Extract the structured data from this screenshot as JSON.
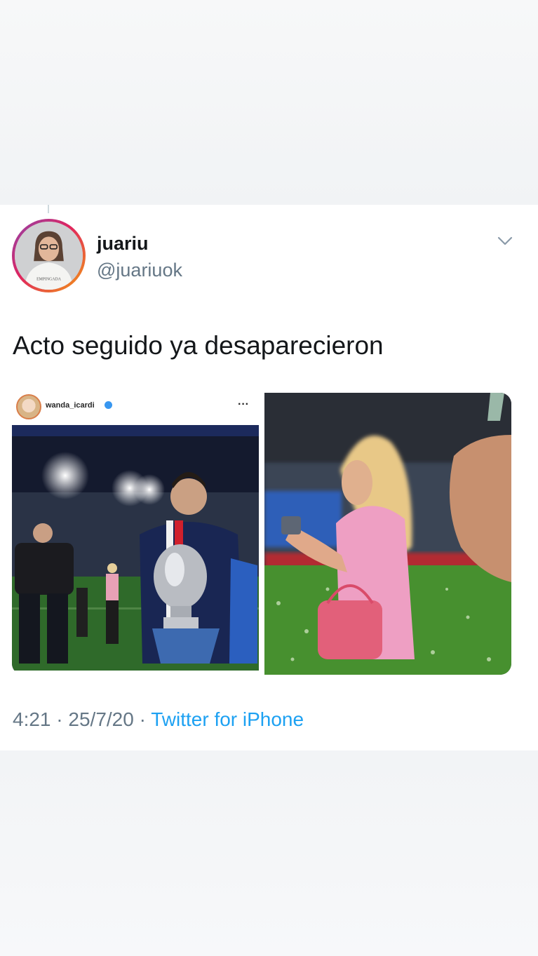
{
  "tweet": {
    "display_name": "juariu",
    "handle": "@juariuok",
    "text": "Acto seguido ya desaparecieron",
    "time": "4:21",
    "date": "25/7/20",
    "separator": "·",
    "source": "Twitter for iPhone",
    "menu_icon": "chevron-down-icon",
    "avatar_shirt_text": "EMPINGADA"
  },
  "media": {
    "left_post": {
      "username": "wanda_icardi",
      "verified": true,
      "more_icon": "ellipsis-icon"
    }
  },
  "colors": {
    "text": "#14171a",
    "secondary": "#657786",
    "link": "#1da1f2"
  }
}
